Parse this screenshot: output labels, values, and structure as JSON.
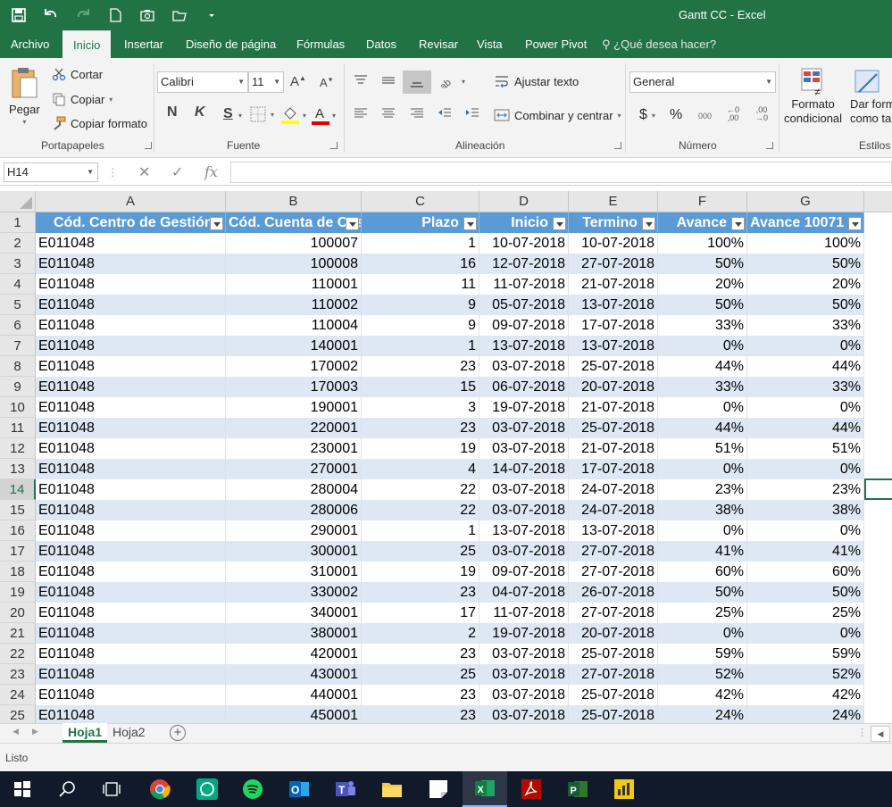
{
  "window": {
    "title": "Gantt CC - Excel"
  },
  "tabs": [
    "Archivo",
    "Inicio",
    "Insertar",
    "Diseño de página",
    "Fórmulas",
    "Datos",
    "Revisar",
    "Vista",
    "Power Pivot"
  ],
  "tell_me": "¿Qué desea hacer?",
  "ribbon": {
    "clipboard": {
      "paste": "Pegar",
      "cut": "Cortar",
      "copy": "Copiar",
      "format_painter": "Copiar formato",
      "label": "Portapapeles"
    },
    "font": {
      "name": "Calibri",
      "size": "11",
      "bold": "N",
      "italic": "K",
      "underline": "S",
      "label": "Fuente"
    },
    "alignment": {
      "wrap": "Ajustar texto",
      "merge": "Combinar y centrar",
      "label": "Alineación"
    },
    "number": {
      "format": "General",
      "currency": "$",
      "percent": "%",
      "thousands": "000",
      "inc_decimal": ",00",
      "dec_decimal": ",00",
      "label": "Número"
    },
    "styles": {
      "conditional": "Formato condicional",
      "conditional_l1": "Formato",
      "conditional_l2": "condicional",
      "format_table_l1": "Dar form",
      "format_table_l2": "como ta",
      "label": "Estilos"
    }
  },
  "formula_bar": {
    "name_box": "H14",
    "cancel": "✕",
    "enter": "✓",
    "fx": "fx",
    "formula": ""
  },
  "columns": [
    "A",
    "B",
    "C",
    "D",
    "E",
    "F",
    "G"
  ],
  "table_headers": [
    "Cód. Centro de Gestión",
    "Cód. Cuenta de Cos",
    "Plazo",
    "Inicio",
    "Termino",
    "Avance",
    "Avance 10071"
  ],
  "rows": [
    [
      "E011048",
      "100007",
      "1",
      "10-07-2018",
      "10-07-2018",
      "100%",
      "100%"
    ],
    [
      "E011048",
      "100008",
      "16",
      "12-07-2018",
      "27-07-2018",
      "50%",
      "50%"
    ],
    [
      "E011048",
      "110001",
      "11",
      "11-07-2018",
      "21-07-2018",
      "20%",
      "20%"
    ],
    [
      "E011048",
      "110002",
      "9",
      "05-07-2018",
      "13-07-2018",
      "50%",
      "50%"
    ],
    [
      "E011048",
      "110004",
      "9",
      "09-07-2018",
      "17-07-2018",
      "33%",
      "33%"
    ],
    [
      "E011048",
      "140001",
      "1",
      "13-07-2018",
      "13-07-2018",
      "0%",
      "0%"
    ],
    [
      "E011048",
      "170002",
      "23",
      "03-07-2018",
      "25-07-2018",
      "44%",
      "44%"
    ],
    [
      "E011048",
      "170003",
      "15",
      "06-07-2018",
      "20-07-2018",
      "33%",
      "33%"
    ],
    [
      "E011048",
      "190001",
      "3",
      "19-07-2018",
      "21-07-2018",
      "0%",
      "0%"
    ],
    [
      "E011048",
      "220001",
      "23",
      "03-07-2018",
      "25-07-2018",
      "44%",
      "44%"
    ],
    [
      "E011048",
      "230001",
      "19",
      "03-07-2018",
      "21-07-2018",
      "51%",
      "51%"
    ],
    [
      "E011048",
      "270001",
      "4",
      "14-07-2018",
      "17-07-2018",
      "0%",
      "0%"
    ],
    [
      "E011048",
      "280004",
      "22",
      "03-07-2018",
      "24-07-2018",
      "23%",
      "23%"
    ],
    [
      "E011048",
      "280006",
      "22",
      "03-07-2018",
      "24-07-2018",
      "38%",
      "38%"
    ],
    [
      "E011048",
      "290001",
      "1",
      "13-07-2018",
      "13-07-2018",
      "0%",
      "0%"
    ],
    [
      "E011048",
      "300001",
      "25",
      "03-07-2018",
      "27-07-2018",
      "41%",
      "41%"
    ],
    [
      "E011048",
      "310001",
      "19",
      "09-07-2018",
      "27-07-2018",
      "60%",
      "60%"
    ],
    [
      "E011048",
      "330002",
      "23",
      "04-07-2018",
      "26-07-2018",
      "50%",
      "50%"
    ],
    [
      "E011048",
      "340001",
      "17",
      "11-07-2018",
      "27-07-2018",
      "25%",
      "25%"
    ],
    [
      "E011048",
      "380001",
      "2",
      "19-07-2018",
      "20-07-2018",
      "0%",
      "0%"
    ],
    [
      "E011048",
      "420001",
      "23",
      "03-07-2018",
      "25-07-2018",
      "59%",
      "59%"
    ],
    [
      "E011048",
      "430001",
      "25",
      "03-07-2018",
      "27-07-2018",
      "52%",
      "52%"
    ],
    [
      "E011048",
      "440001",
      "23",
      "03-07-2018",
      "25-07-2018",
      "42%",
      "42%"
    ],
    [
      "E011048",
      "450001",
      "23",
      "03-07-2018",
      "25-07-2018",
      "24%",
      "24%"
    ]
  ],
  "row_numbers": [
    "1",
    "2",
    "3",
    "4",
    "5",
    "6",
    "7",
    "8",
    "9",
    "10",
    "11",
    "12",
    "13",
    "14",
    "15",
    "16",
    "17",
    "18",
    "19",
    "20",
    "21",
    "22",
    "23",
    "24",
    "25"
  ],
  "selected_row": 14,
  "sheets": [
    "Hoja1",
    "Hoja2"
  ],
  "active_sheet": "Hoja1",
  "status": "Listo",
  "taskbar": [
    "windows-start",
    "search",
    "task-view",
    "chrome",
    "whatsapp",
    "spotify",
    "outlook",
    "teams",
    "file-explorer",
    "notes",
    "excel",
    "acrobat",
    "project",
    "power-bi"
  ],
  "colors": {
    "excel_green": "#217346",
    "header_blue": "#5b9bd5",
    "band_blue": "#dde8f4",
    "taskbar": "#101a2a"
  }
}
